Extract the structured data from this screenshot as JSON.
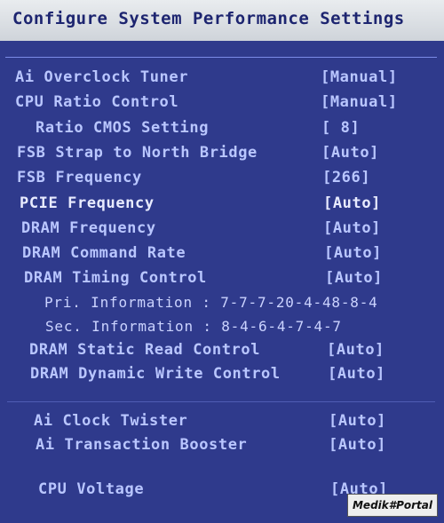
{
  "title": "Configure System Performance Settings",
  "rows": [
    {
      "label": "Ai Overclock Tuner",
      "value": "[Manual]"
    },
    {
      "label": "CPU Ratio Control",
      "value": "[Manual]"
    },
    {
      "label": "Ratio CMOS Setting",
      "value": "[ 8]"
    },
    {
      "label": "FSB Strap to North Bridge",
      "value": "[Auto]"
    },
    {
      "label": "FSB Frequency",
      "value": "[266]"
    },
    {
      "label": "PCIE Frequency",
      "value": "[Auto]"
    },
    {
      "label": "DRAM Frequency",
      "value": "[Auto]"
    },
    {
      "label": "DRAM Command Rate",
      "value": "[Auto]"
    },
    {
      "label": "DRAM Timing Control",
      "value": "[Auto]"
    },
    {
      "label": "DRAM Static Read Control",
      "value": "[Auto]"
    },
    {
      "label": "DRAM Dynamic Write Control",
      "value": "[Auto]"
    },
    {
      "label": "Ai Clock Twister",
      "value": "[Auto]"
    },
    {
      "label": "Ai Transaction Booster",
      "value": "[Auto]"
    },
    {
      "label": "CPU Voltage",
      "value": "[Auto]"
    }
  ],
  "info": {
    "primary": "Pri. Information : 7-7-7-20-4-48-8-4",
    "secondary": "Sec. Information : 8-4-6-4-7-4-7"
  },
  "watermark": "Medik#Portal",
  "colors": {
    "background": "#2f3a8c",
    "title_bar": "#e9ecef",
    "text": "#b9c6ff",
    "highlight": "#e8ebff"
  }
}
